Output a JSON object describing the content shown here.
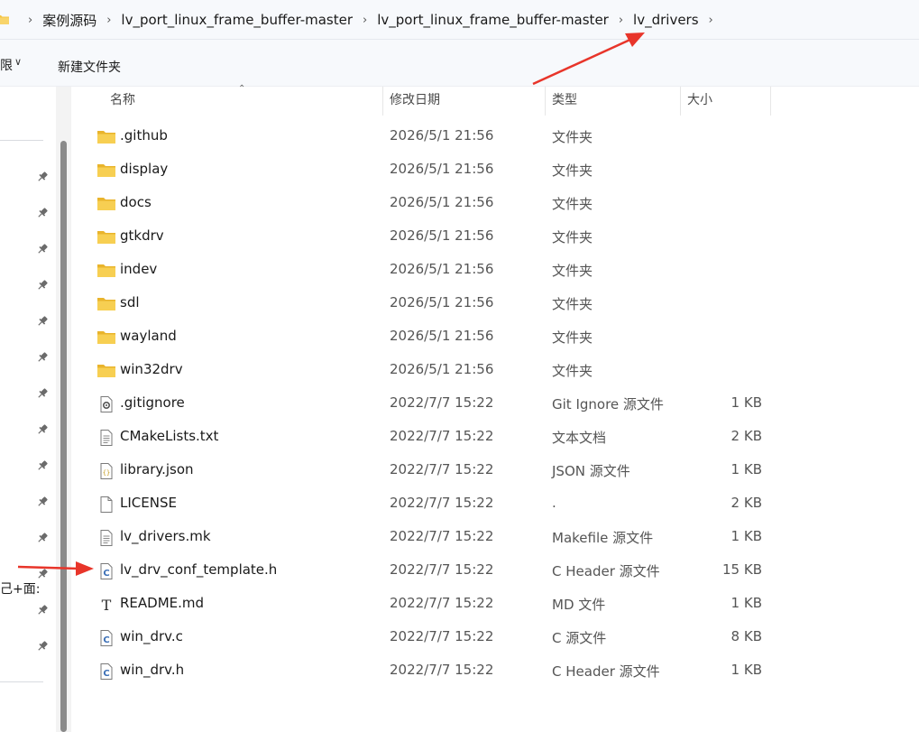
{
  "breadcrumb": {
    "items": [
      {
        "label": "案例源码"
      },
      {
        "label": "lv_port_linux_frame_buffer-master"
      },
      {
        "label": "lv_port_linux_frame_buffer-master"
      },
      {
        "label": "lv_drivers"
      }
    ]
  },
  "toolbar": {
    "cut_text": "限",
    "new_folder_label": "新建文件夹"
  },
  "nav": {
    "partial_text": "己+面:"
  },
  "columns": {
    "name": "名称",
    "date": "修改日期",
    "type": "类型",
    "size": "大小"
  },
  "files": [
    {
      "name": ".github",
      "date": "2026/5/1 21:56",
      "type": "文件夹",
      "size": "",
      "icon": "folder-icon"
    },
    {
      "name": "display",
      "date": "2026/5/1 21:56",
      "type": "文件夹",
      "size": "",
      "icon": "folder-icon"
    },
    {
      "name": "docs",
      "date": "2026/5/1 21:56",
      "type": "文件夹",
      "size": "",
      "icon": "folder-icon"
    },
    {
      "name": "gtkdrv",
      "date": "2026/5/1 21:56",
      "type": "文件夹",
      "size": "",
      "icon": "folder-icon"
    },
    {
      "name": "indev",
      "date": "2026/5/1 21:56",
      "type": "文件夹",
      "size": "",
      "icon": "folder-icon"
    },
    {
      "name": "sdl",
      "date": "2026/5/1 21:56",
      "type": "文件夹",
      "size": "",
      "icon": "folder-icon"
    },
    {
      "name": "wayland",
      "date": "2026/5/1 21:56",
      "type": "文件夹",
      "size": "",
      "icon": "folder-icon"
    },
    {
      "name": "win32drv",
      "date": "2026/5/1 21:56",
      "type": "文件夹",
      "size": "",
      "icon": "folder-icon"
    },
    {
      "name": ".gitignore",
      "date": "2022/7/7 15:22",
      "type": "Git Ignore 源文件",
      "size": "1 KB",
      "icon": "settings-file-icon"
    },
    {
      "name": "CMakeLists.txt",
      "date": "2022/7/7 15:22",
      "type": "文本文档",
      "size": "2 KB",
      "icon": "text-file-icon"
    },
    {
      "name": "library.json",
      "date": "2022/7/7 15:22",
      "type": "JSON 源文件",
      "size": "1 KB",
      "icon": "json-file-icon"
    },
    {
      "name": "LICENSE",
      "date": "2022/7/7 15:22",
      "type": ".",
      "size": "2 KB",
      "icon": "blank-file-icon"
    },
    {
      "name": "lv_drivers.mk",
      "date": "2022/7/7 15:22",
      "type": "Makefile 源文件",
      "size": "1 KB",
      "icon": "text-file-icon"
    },
    {
      "name": "lv_drv_conf_template.h",
      "date": "2022/7/7 15:22",
      "type": "C Header 源文件",
      "size": "15 KB",
      "icon": "c-file-icon"
    },
    {
      "name": "README.md",
      "date": "2022/7/7 15:22",
      "type": "MD 文件",
      "size": "1 KB",
      "icon": "markdown-file-icon"
    },
    {
      "name": "win_drv.c",
      "date": "2022/7/7 15:22",
      "type": "C 源文件",
      "size": "8 KB",
      "icon": "c-file-icon"
    },
    {
      "name": "win_drv.h",
      "date": "2022/7/7 15:22",
      "type": "C Header 源文件",
      "size": "1 KB",
      "icon": "c-file-icon"
    }
  ],
  "colors": {
    "folder": "#f5c542",
    "accent_blue": "#3b6fb6",
    "annotation_red": "#e8352a"
  }
}
